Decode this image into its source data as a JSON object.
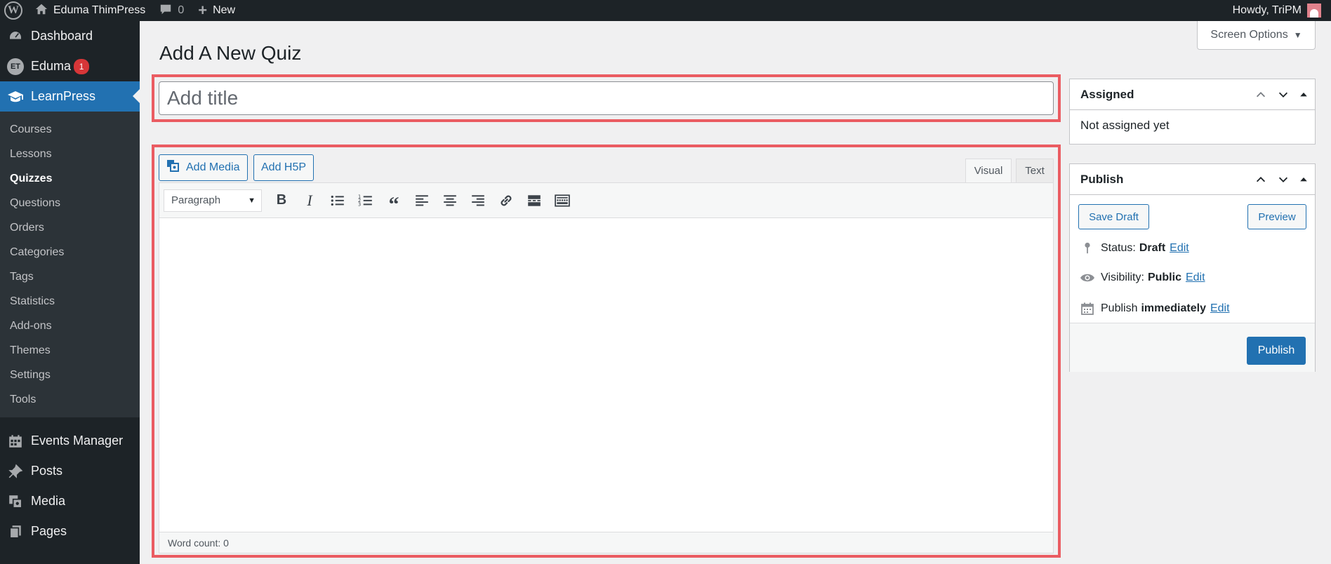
{
  "adminbar": {
    "site_name": "Eduma ThimPress",
    "comments_count": "0",
    "new_label": "New",
    "greeting": "Howdy, TriPM"
  },
  "sidebar": {
    "top_items": [
      {
        "label": "Dashboard",
        "icon": "dashboard-icon"
      },
      {
        "label": "Eduma",
        "icon": "eduma-icon",
        "badge": "1"
      },
      {
        "label": "LearnPress",
        "icon": "learnpress-icon"
      }
    ],
    "submenu": [
      "Courses",
      "Lessons",
      "Quizzes",
      "Questions",
      "Orders",
      "Categories",
      "Tags",
      "Statistics",
      "Add-ons",
      "Themes",
      "Settings",
      "Tools"
    ],
    "bottom_items": [
      {
        "label": "Events Manager",
        "icon": "calendar-icon"
      },
      {
        "label": "Posts",
        "icon": "pin-icon"
      },
      {
        "label": "Media",
        "icon": "media-icon"
      },
      {
        "label": "Pages",
        "icon": "pages-icon"
      }
    ]
  },
  "header": {
    "screen_options": "Screen Options",
    "page_title": "Add A New Quiz"
  },
  "title_field": {
    "placeholder": "Add title",
    "value": ""
  },
  "editor": {
    "add_media": "Add Media",
    "add_h5p": "Add H5P",
    "tab_visual": "Visual",
    "tab_text": "Text",
    "format_select": "Paragraph",
    "word_count": "Word count: 0"
  },
  "assigned_box": {
    "title": "Assigned",
    "content": "Not assigned yet"
  },
  "publish_box": {
    "title": "Publish",
    "save_draft": "Save Draft",
    "preview": "Preview",
    "status_label": "Status:",
    "status_value": "Draft",
    "visibility_label": "Visibility:",
    "visibility_value": "Public",
    "publish_label": "Publish",
    "publish_value": "immediately",
    "edit_label": "Edit",
    "publish_button": "Publish"
  },
  "colors": {
    "accent": "#2271b1",
    "highlight_frame": "#ea5c62",
    "sidebar_bg": "#1d2327",
    "badge": "#d63638"
  }
}
